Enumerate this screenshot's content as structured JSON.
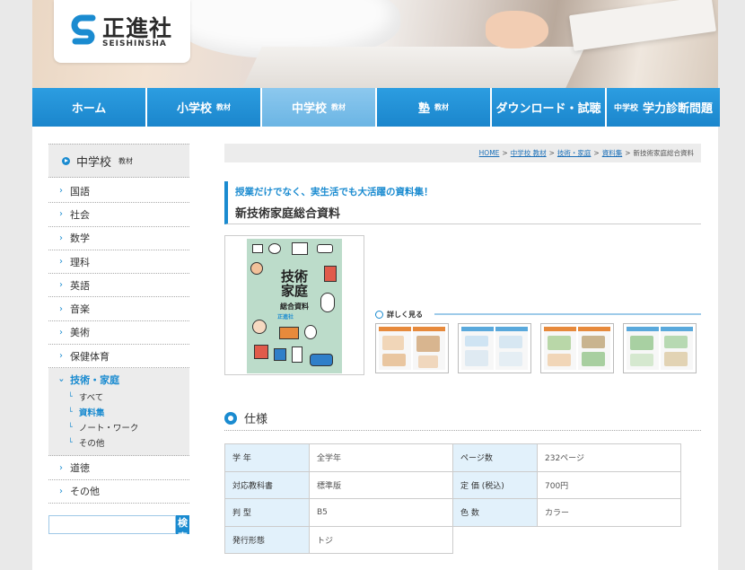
{
  "logo": {
    "name": "正進社",
    "sub": "SEISHINSHA"
  },
  "nav": [
    {
      "label": "ホーム",
      "pre": "",
      "tag": "",
      "active": false
    },
    {
      "label": "小学校",
      "pre": "",
      "tag": "教材",
      "active": false
    },
    {
      "label": "中学校",
      "pre": "",
      "tag": "教材",
      "active": true
    },
    {
      "label": "塾",
      "pre": "",
      "tag": "教材",
      "active": false
    },
    {
      "label": "ダウンロード・試聴",
      "pre": "",
      "tag": "",
      "active": false
    },
    {
      "label": "学力診断問題",
      "pre": "中学校",
      "tag": "",
      "active": false
    }
  ],
  "sidebar": {
    "heading": "中学校",
    "heading_tag": "教材",
    "items_before": [
      "国語",
      "社会",
      "数学",
      "理科",
      "英語",
      "音楽",
      "美術",
      "保健体育"
    ],
    "open_item": "技術・家庭",
    "sub_items": [
      "すべて",
      "資料集",
      "ノート・ワーク",
      "その他"
    ],
    "current_sub": "資料集",
    "items_after": [
      "道徳",
      "その他"
    ]
  },
  "search": {
    "placeholder": "",
    "button": "検索"
  },
  "breadcrumb": {
    "links": [
      "HOME",
      "中学校 教材",
      "技術・家庭",
      "資料集"
    ],
    "current": "新技術家庭総合資料",
    "separator": ">"
  },
  "product": {
    "lead": "授業だけでなく、実生活でも大活躍の資料集！",
    "title": "新技術家庭総合資料",
    "cover_title_1": "技術",
    "cover_title_2": "家庭",
    "cover_sub": "総合資料",
    "cover_publisher": "正進社",
    "detail_label": "詳しく見る"
  },
  "spec": {
    "heading": "仕様",
    "left": [
      {
        "k": "学 年",
        "v": "全学年"
      },
      {
        "k": "対応教科書",
        "v": "標準版"
      },
      {
        "k": "判 型",
        "v": "B5"
      },
      {
        "k": "発行形態",
        "v": "トジ"
      }
    ],
    "right": [
      {
        "k": "ページ数",
        "v": "232ページ"
      },
      {
        "k": "定 価 (税込)",
        "v": "700円"
      },
      {
        "k": "色 数",
        "v": "カラー"
      }
    ]
  },
  "colors": {
    "accent": "#1a8bd0",
    "nav_active": "#7bbde8",
    "cover_bg": "#bcdcca"
  }
}
